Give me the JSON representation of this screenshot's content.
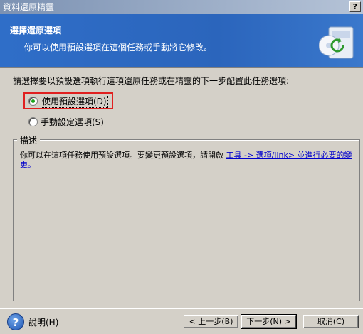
{
  "window": {
    "title": "資料還原精靈",
    "help_button": "?"
  },
  "header": {
    "title": "選擇還原選項",
    "subtitle": "你可以使用預設選項在這個任務或手動將它修改。",
    "graphic_icon": "restore-options-icon"
  },
  "prompt": "請選擇要以預設選項執行這項還原任務或在精靈的下一步配置此任務選項:",
  "options": [
    {
      "label": "使用預設選項(D)",
      "selected": true
    },
    {
      "label": "手動設定選項(S)",
      "selected": false
    }
  ],
  "description": {
    "legend": "描述",
    "text": "你可以在這項任務使用預設選項。要變更預設選項，請開啟 ",
    "link": "工具 -> 選項/link> 並進行必要的變更。"
  },
  "footer": {
    "help_label": "說明(H)",
    "back_label": "< 上一步(B)",
    "next_label": "下一步(N) >",
    "cancel_label": "取消(C)"
  }
}
